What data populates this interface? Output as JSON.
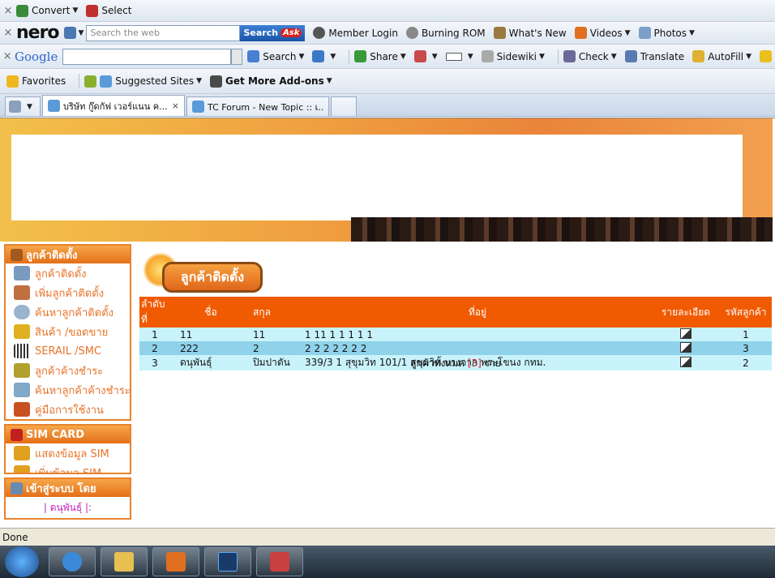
{
  "toolbars": {
    "convert": {
      "convert_label": "Convert",
      "select_label": "Select"
    },
    "nero": {
      "logo": "nero",
      "search_placeholder": "Search the web",
      "search_button": "Search",
      "ask_badge": "Ask",
      "member_login": "Member Login",
      "burning_rom": "Burning ROM",
      "whats_new": "What's New",
      "videos": "Videos",
      "photos": "Photos"
    },
    "google": {
      "logo": "Google",
      "search": "Search",
      "share": "Share",
      "sidewiki": "Sidewiki",
      "check": "Check",
      "translate": "Translate",
      "autofill": "AutoFill"
    },
    "favorites": {
      "favorites_label": "Favorites",
      "suggested_sites": "Suggested Sites",
      "get_more_addons": "Get More Add-ons"
    }
  },
  "tabs": [
    {
      "label": "บริษัท กู๊ดกัฟ เวอร์แนน ค..."
    },
    {
      "label": "TC Forum - New Topic :: เ..."
    }
  ],
  "sidebar": {
    "customer_box": {
      "title": "ลูกค้าติดตั้ง",
      "items": [
        "ลูกค้าติดตั้ง",
        "เพิ่มลูกค้าติดตั้ง",
        "ค้นหาลูกค้าติดตั้ง",
        "สินค้า /ขอดขาย",
        "SERAIL /SMC",
        "ลูกค้าค้างชำระ",
        "ค้นหาลูกค้าค้างชำระ",
        "คู่มือการใช้งาน"
      ]
    },
    "sim_box": {
      "title": "SIM CARD",
      "items": [
        "แสดงข้อมูล SIM",
        "เพิ่มข้อมูล SIM"
      ]
    },
    "login_box": {
      "title": "เข้าสู่ระบบ โดย",
      "user": "| ดนุพันธุ์ |:"
    }
  },
  "main": {
    "heading": "ลูกค้าติดตั้ง",
    "table": {
      "headers": [
        "ลำดับที่",
        "ชื่อ",
        "สกุล",
        "ที่อยู่",
        "รายละเอียด",
        "รหัสลูกค้า"
      ],
      "rows": [
        {
          "no": "1",
          "name": "11",
          "surname": "11",
          "address": "1 11 1 1 1 1 1",
          "code": "1"
        },
        {
          "no": "2",
          "name": "222",
          "surname": "2",
          "address": "2 2 2 2 2 2 2",
          "code": "3"
        },
        {
          "no": "3",
          "name": "ดนุพันธุ์",
          "surname": "ปิมปาตัน",
          "address": "339/3 1 สุขุมวิท 101/1 สุขุมวิท บางจาก พระโขนง กทม.",
          "code": "2"
        }
      ]
    },
    "total_prefix": "ลูกค้าทั้งหมด",
    "total_count": "[3]",
    "total_suffix": "ราย"
  },
  "status": {
    "text": "Done"
  }
}
